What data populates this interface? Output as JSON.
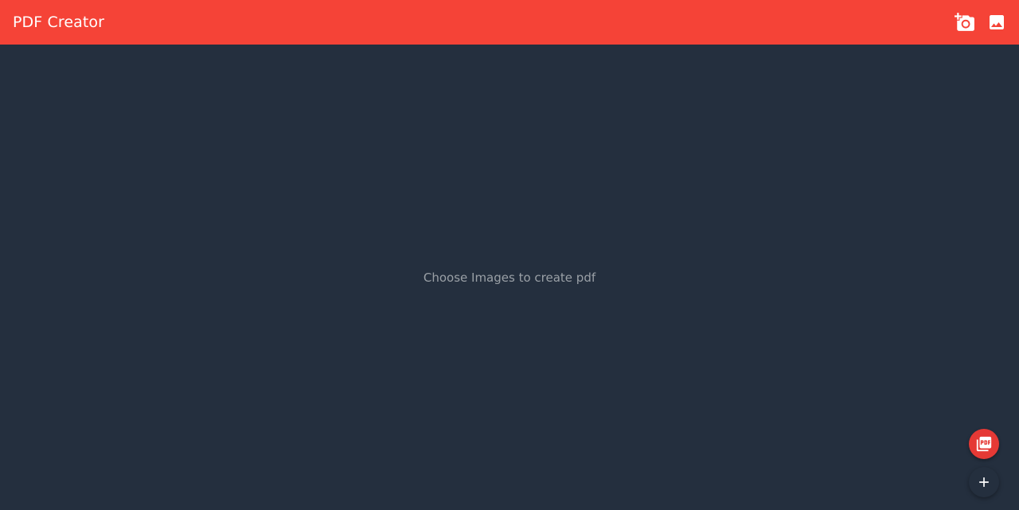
{
  "appbar": {
    "title": "PDF Creator",
    "actions": [
      {
        "icon": "add-a-photo-icon",
        "label": "Take photo"
      },
      {
        "icon": "image-icon",
        "label": "Choose image"
      }
    ]
  },
  "main": {
    "empty_message": "Choose Images to create pdf"
  },
  "fabs": [
    {
      "icon": "picture-as-pdf-icon"
    },
    {
      "icon": "add-icon"
    }
  ],
  "colors": {
    "appbar": "#f54337",
    "background": "#242f3e",
    "fab_pdf": "#e53935",
    "text_muted": "#9aa0a6"
  }
}
